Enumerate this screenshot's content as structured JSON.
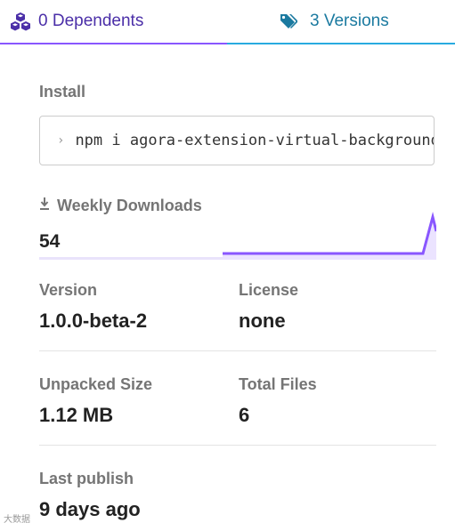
{
  "tabs": {
    "dependents": {
      "label": "0 Dependents",
      "icon": "cubes-icon"
    },
    "versions": {
      "label": "3 Versions",
      "icon": "tags-icon"
    }
  },
  "install": {
    "label": "Install",
    "prompt": "›",
    "command": "npm i agora-extension-virtual-background"
  },
  "weekly_downloads": {
    "label": "Weekly Downloads",
    "icon": "download-icon",
    "value": "54",
    "color": "#8956ff"
  },
  "version": {
    "label": "Version",
    "value": "1.0.0-beta-2"
  },
  "license": {
    "label": "License",
    "value": "none"
  },
  "unpacked_size": {
    "label": "Unpacked Size",
    "value": "1.12 MB"
  },
  "total_files": {
    "label": "Total Files",
    "value": "6"
  },
  "last_publish": {
    "label": "Last publish",
    "value": "9 days ago"
  },
  "watermark": "大数据"
}
